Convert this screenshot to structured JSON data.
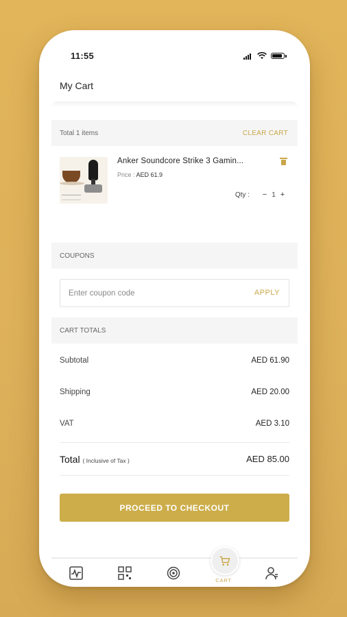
{
  "status_bar": {
    "time": "11:55"
  },
  "header": {
    "title": "My Cart"
  },
  "cart_summary": {
    "total_items_label": "Total 1 items",
    "clear_cart_label": "CLEAR CART"
  },
  "cart_items": [
    {
      "name": "Anker Soundcore Strike 3 Gamin...",
      "price_label": "Price :",
      "price": "AED 61.9",
      "qty_label": "Qty :",
      "qty": "1",
      "minus": "−",
      "plus": "+"
    }
  ],
  "coupons": {
    "section_label": "COUPONS",
    "input_placeholder": "Enter coupon code",
    "apply_label": "APPLY"
  },
  "totals": {
    "section_label": "CART TOTALS",
    "subtotal_label": "Subtotal",
    "subtotal_value": "AED 61.90",
    "shipping_label": "Shipping",
    "shipping_value": "AED 20.00",
    "vat_label": "VAT",
    "vat_value": "AED 3.10",
    "total_label": "Total",
    "total_note": "( Inclusive of Tax )",
    "total_value": "AED 85.00"
  },
  "checkout": {
    "label": "PROCEED TO CHECKOUT"
  },
  "tabbar": {
    "tabs": [
      {
        "name": "dashboard",
        "icon": "monitor-pulse-icon"
      },
      {
        "name": "qr-scan",
        "icon": "qr-code-icon"
      },
      {
        "name": "target",
        "icon": "target-icon"
      },
      {
        "name": "cart",
        "icon": "cart-icon",
        "label": "CART",
        "active": true
      },
      {
        "name": "profile",
        "icon": "user-icon"
      }
    ]
  },
  "colors": {
    "accent": "#ccad4a",
    "background": "#e0b35a"
  }
}
